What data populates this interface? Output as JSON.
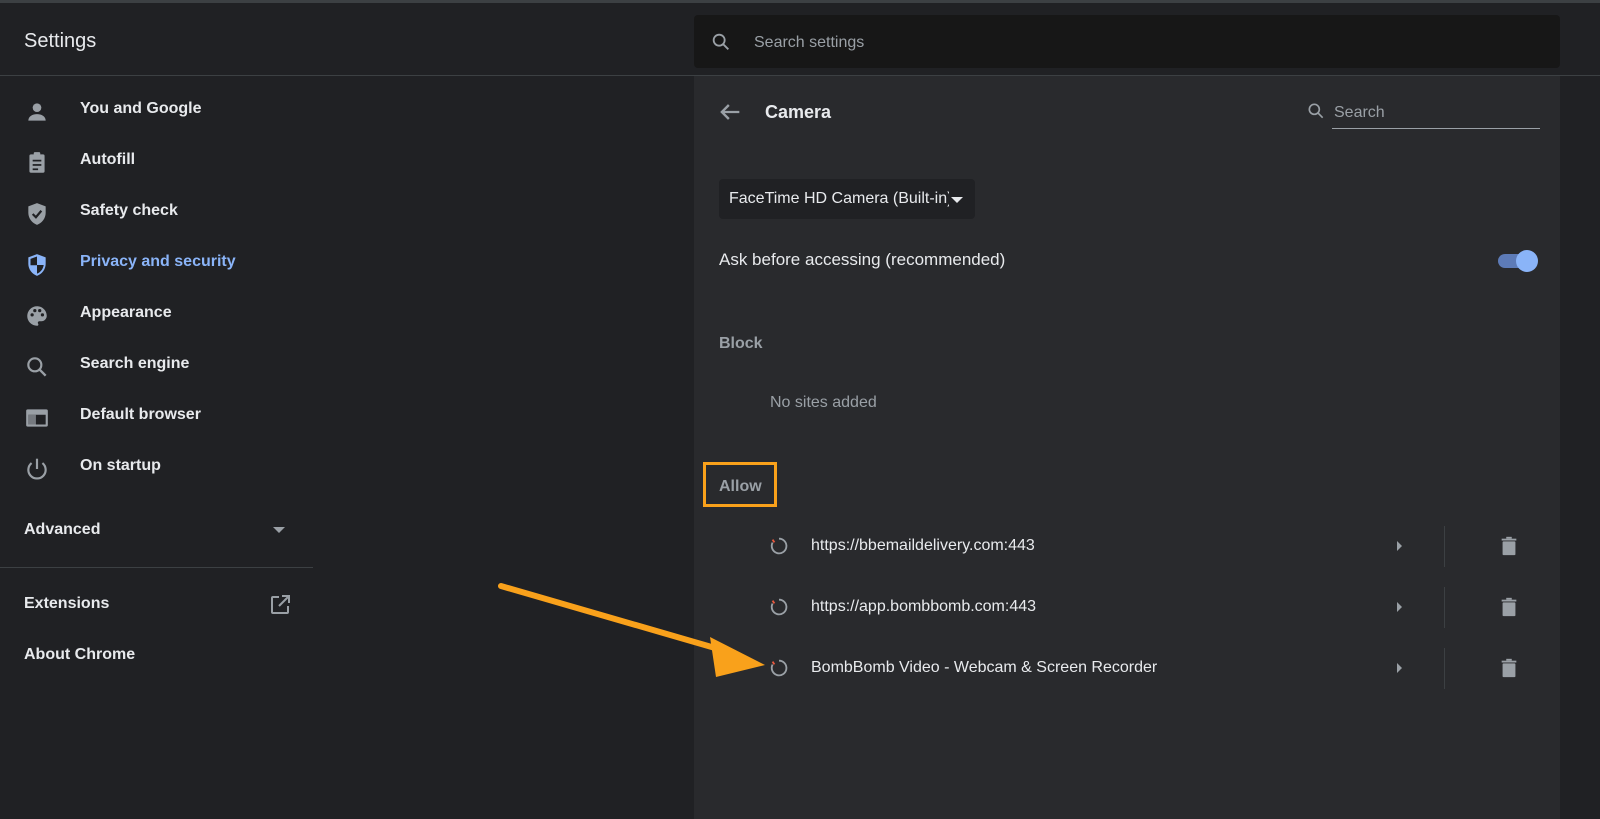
{
  "app": {
    "title": "Settings"
  },
  "search": {
    "placeholder": "Search settings"
  },
  "sidebar": {
    "items": [
      {
        "label": "You and Google",
        "icon": "person-icon"
      },
      {
        "label": "Autofill",
        "icon": "clipboard-icon"
      },
      {
        "label": "Safety check",
        "icon": "shield-check-icon"
      },
      {
        "label": "Privacy and security",
        "icon": "shield-half-icon",
        "active": true
      },
      {
        "label": "Appearance",
        "icon": "palette-icon"
      },
      {
        "label": "Search engine",
        "icon": "search-icon"
      },
      {
        "label": "Default browser",
        "icon": "browser-icon"
      },
      {
        "label": "On startup",
        "icon": "power-icon"
      }
    ],
    "advanced": "Advanced",
    "extensions": "Extensions",
    "about": "About Chrome"
  },
  "camera": {
    "title": "Camera",
    "search_placeholder": "Search",
    "device": "FaceTime HD Camera (Built-in)",
    "ask_label": "Ask before accessing (recommended)",
    "ask_enabled": true,
    "block_label": "Block",
    "block_empty": "No sites added",
    "allow_label": "Allow",
    "allowed_sites": [
      "https://bbemaildelivery.com:443",
      "https://app.bombbomb.com:443",
      "BombBomb Video - Webcam & Screen Recorder"
    ]
  },
  "colors": {
    "accent": "#8ab4f8",
    "annotation": "#f9a11b",
    "background": "#202124",
    "panel": "#292a2d"
  }
}
